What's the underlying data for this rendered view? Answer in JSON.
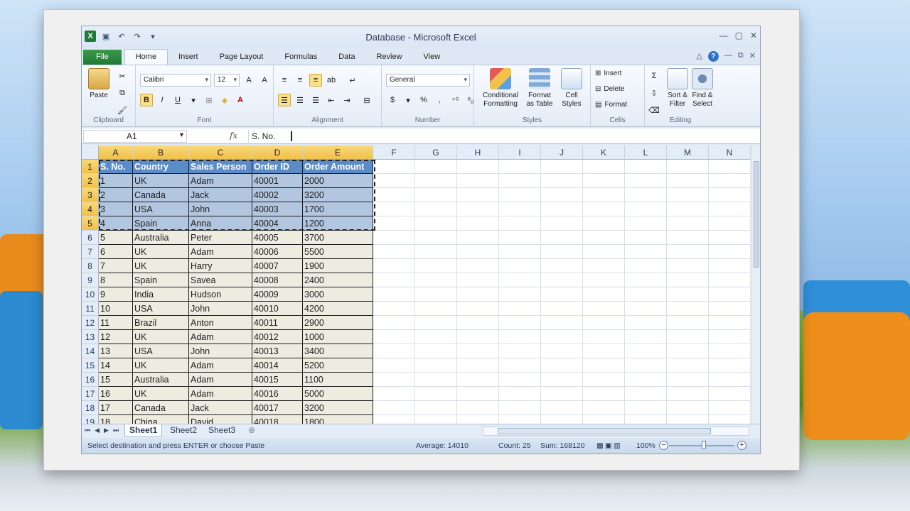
{
  "window": {
    "title": "Database - Microsoft Excel"
  },
  "tabs": [
    {
      "label": "File"
    },
    {
      "label": "Home"
    },
    {
      "label": "Insert"
    },
    {
      "label": "Page Layout"
    },
    {
      "label": "Formulas"
    },
    {
      "label": "Data"
    },
    {
      "label": "Review"
    },
    {
      "label": "View"
    }
  ],
  "ribbon": {
    "clipboard": {
      "label": "Clipboard",
      "paste": "Paste"
    },
    "font": {
      "label": "Font",
      "name": "Calibri",
      "size": "12"
    },
    "alignment": {
      "label": "Alignment"
    },
    "number": {
      "label": "Number",
      "format": "General"
    },
    "styles": {
      "label": "Styles",
      "conditional": "Conditional Formatting",
      "format_table": "Format as Table",
      "cell_styles": "Cell Styles"
    },
    "cells": {
      "label": "Cells",
      "insert": "Insert",
      "delete": "Delete",
      "format": "Format"
    },
    "editing": {
      "label": "Editing",
      "sort": "Sort & Filter",
      "find": "Find & Select"
    }
  },
  "formula_bar": {
    "name_box": "A1",
    "value": "S. No."
  },
  "columns": [
    "A",
    "B",
    "C",
    "D",
    "E",
    "F",
    "G",
    "H",
    "I",
    "J",
    "K",
    "L",
    "M",
    "N"
  ],
  "table_header": [
    "S. No.",
    "Country",
    "Sales Person",
    "Order ID",
    "Order Amount"
  ],
  "rows": [
    [
      "1",
      "UK",
      "Adam",
      "40001",
      "2000"
    ],
    [
      "2",
      "Canada",
      "Jack",
      "40002",
      "3200"
    ],
    [
      "3",
      "USA",
      "John",
      "40003",
      "1700"
    ],
    [
      "4",
      "Spain",
      "Anna",
      "40004",
      "1200"
    ],
    [
      "5",
      "Australia",
      "Peter",
      "40005",
      "3700"
    ],
    [
      "6",
      "UK",
      "Adam",
      "40006",
      "5500"
    ],
    [
      "7",
      "UK",
      "Harry",
      "40007",
      "1900"
    ],
    [
      "8",
      "Spain",
      "Savea",
      "40008",
      "2400"
    ],
    [
      "9",
      "India",
      "Hudson",
      "40009",
      "3000"
    ],
    [
      "10",
      "USA",
      "John",
      "40010",
      "4200"
    ],
    [
      "11",
      "Brazil",
      "Anton",
      "40011",
      "2900"
    ],
    [
      "12",
      "UK",
      "Adam",
      "40012",
      "1000"
    ],
    [
      "13",
      "USA",
      "John",
      "40013",
      "3400"
    ],
    [
      "14",
      "UK",
      "Adam",
      "40014",
      "5200"
    ],
    [
      "15",
      "Australia",
      "Adam",
      "40015",
      "1100"
    ],
    [
      "16",
      "UK",
      "Adam",
      "40016",
      "5000"
    ],
    [
      "17",
      "Canada",
      "Jack",
      "40017",
      "3200"
    ],
    [
      "18",
      "China",
      "David",
      "40018",
      "1800"
    ]
  ],
  "row_numbers": [
    "1",
    "2",
    "3",
    "4",
    "5",
    "6",
    "7",
    "8",
    "9",
    "10",
    "11",
    "12",
    "13",
    "14",
    "15",
    "16",
    "17",
    "18",
    "19"
  ],
  "sheets": [
    "Sheet1",
    "Sheet2",
    "Sheet3"
  ],
  "status": {
    "message": "Select destination and press ENTER or choose Paste",
    "average": "Average: 14010",
    "count": "Count: 25",
    "sum": "Sum: 168120",
    "zoom": "100%"
  },
  "colors": {
    "header_fill": "#4f81bd",
    "row_fill": "#eeece1",
    "selection": "#b3c6e0"
  }
}
